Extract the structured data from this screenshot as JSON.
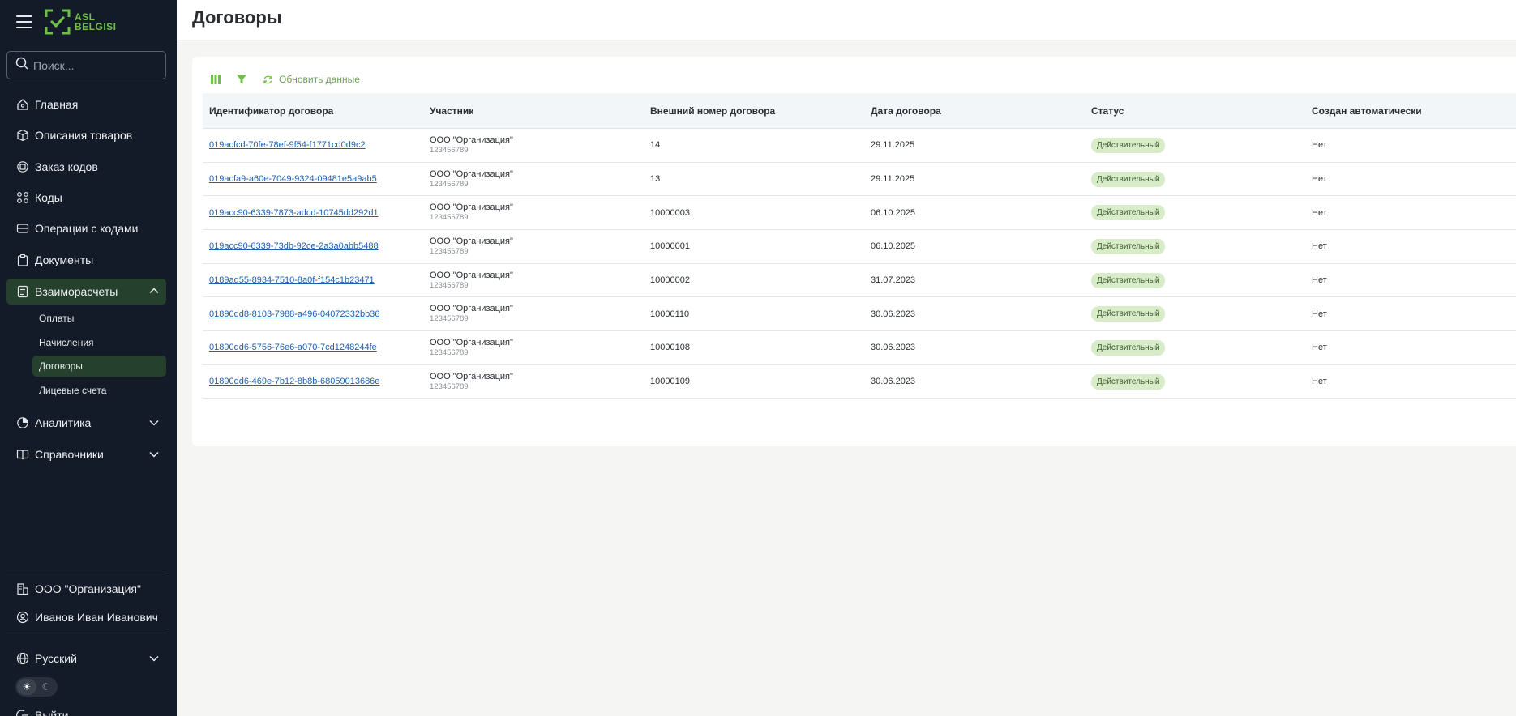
{
  "brand": {
    "line1": "ASL",
    "line2": "BELGISI"
  },
  "search": {
    "placeholder": "Поиск..."
  },
  "nav": {
    "main": "Главная",
    "products": "Описания товаров",
    "order_codes": "Заказ кодов",
    "codes": "Коды",
    "code_ops": "Операции с кодами",
    "documents": "Документы",
    "settlements": "Взаиморасчеты",
    "sub": {
      "payments": "Оплаты",
      "charges": "Начисления",
      "contracts": "Договоры",
      "accounts": "Лицевые счета"
    },
    "analytics": "Аналитика",
    "references": "Справочники"
  },
  "footer": {
    "org": "ООО \"Организация\"",
    "user": "Иванов Иван Иванович",
    "language": "Русский",
    "logout": "Выйти"
  },
  "page": {
    "title": "Договоры"
  },
  "toolbar": {
    "refresh_label": "Обновить данные"
  },
  "table": {
    "headers": [
      "Идентификатор договора",
      "Участник",
      "Внешний номер договора",
      "Дата договора",
      "Статус",
      "Создан автоматически"
    ],
    "rows": [
      {
        "id": "019acfcd-70fe-78ef-9f54-f1771cd0d9c2",
        "org": "ООО \"Организация\"",
        "inn": "123456789",
        "ext": "14",
        "date": "29.11.2025",
        "status": "Действительный",
        "auto": "Нет"
      },
      {
        "id": "019acfa9-a60e-7049-9324-09481e5a9ab5",
        "org": "ООО \"Организация\"",
        "inn": "123456789",
        "ext": "13",
        "date": "29.11.2025",
        "status": "Действительный",
        "auto": "Нет"
      },
      {
        "id": "019acc90-6339-7873-adcd-10745dd292d1",
        "org": "ООО \"Организация\"",
        "inn": "123456789",
        "ext": "10000003",
        "date": "06.10.2025",
        "status": "Действительный",
        "auto": "Нет"
      },
      {
        "id": "019acc90-6339-73db-92ce-2a3a0abb5488",
        "org": "ООО \"Организация\"",
        "inn": "123456789",
        "ext": "10000001",
        "date": "06.10.2025",
        "status": "Действительный",
        "auto": "Нет"
      },
      {
        "id": "0189ad55-8934-7510-8a0f-f154c1b23471",
        "org": "ООО \"Организация\"",
        "inn": "123456789",
        "ext": "10000002",
        "date": "31.07.2023",
        "status": "Действительный",
        "auto": "Нет"
      },
      {
        "id": "01890dd8-8103-7988-a496-04072332bb36",
        "org": "ООО \"Организация\"",
        "inn": "123456789",
        "ext": "10000110",
        "date": "30.06.2023",
        "status": "Действительный",
        "auto": "Нет"
      },
      {
        "id": "01890dd6-5756-76e6-a070-7cd1248244fe",
        "org": "ООО \"Организация\"",
        "inn": "123456789",
        "ext": "10000108",
        "date": "30.06.2023",
        "status": "Действительный",
        "auto": "Нет"
      },
      {
        "id": "01890dd6-469e-7b12-8b8b-68059013686e",
        "org": "ООО \"Организация\"",
        "inn": "123456789",
        "ext": "10000109",
        "date": "30.06.2023",
        "status": "Действительный",
        "auto": "Нет"
      }
    ]
  },
  "colors": {
    "sidebar_bg": "#131b29",
    "accent": "#6fbf4b",
    "active_bg": "#25402c",
    "badge_bg": "#d9ecc9",
    "link": "#1c5fb3"
  }
}
